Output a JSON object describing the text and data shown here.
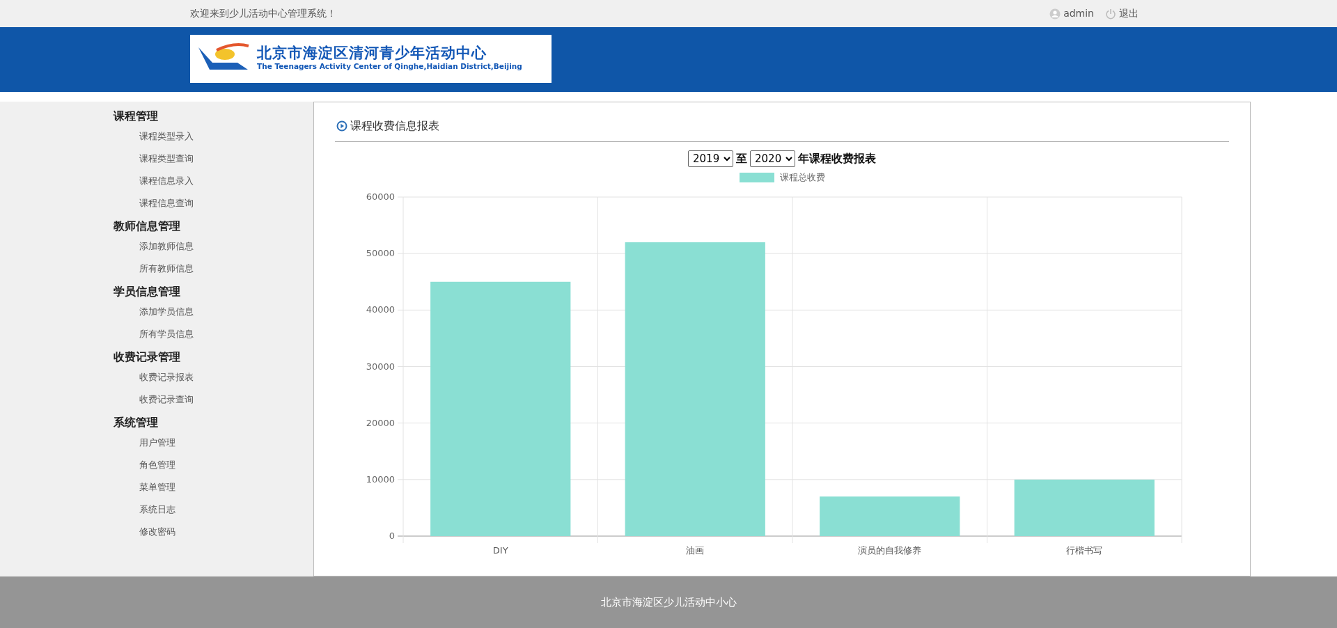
{
  "topbar": {
    "welcome": "欢迎来到少儿活动中心管理系统！",
    "user": "admin",
    "logout": "退出"
  },
  "logo": {
    "title": "北京市海淀区清河青少年活动中心",
    "subtitle": "The Teenagers Activity Center of Qinghe,Haidian District,Beijing"
  },
  "sidebar": {
    "groups": [
      {
        "title": "课程管理",
        "items": [
          "课程类型录入",
          "课程类型查询",
          "课程信息录入",
          "课程信息查询"
        ]
      },
      {
        "title": "教师信息管理",
        "items": [
          "添加教师信息",
          "所有教师信息"
        ]
      },
      {
        "title": "学员信息管理",
        "items": [
          "添加学员信息",
          "所有学员信息"
        ]
      },
      {
        "title": "收费记录管理",
        "items": [
          "收费记录报表",
          "收费记录查询"
        ]
      },
      {
        "title": "系统管理",
        "items": [
          "用户管理",
          "角色管理",
          "菜单管理",
          "系统日志",
          "修改密码"
        ]
      }
    ]
  },
  "panel": {
    "title": "课程收费信息报表",
    "from_year": "2019",
    "separator": "至",
    "to_year": "2020",
    "report_suffix": "年课程收费报表",
    "chart_data": {
      "type": "bar",
      "categories": [
        "DIY",
        "油画",
        "演员的自我修养",
        "行楷书写"
      ],
      "series": [
        {
          "name": "课程总收费",
          "color": "#8adfd3",
          "values": [
            45000,
            52000,
            7000,
            10000
          ]
        }
      ],
      "grid": true,
      "ylim": [
        0,
        60000
      ],
      "yticks": [
        0,
        10000,
        20000,
        30000,
        40000,
        50000,
        60000
      ]
    }
  },
  "footer": {
    "text": "北京市海淀区少儿活动中小心"
  }
}
